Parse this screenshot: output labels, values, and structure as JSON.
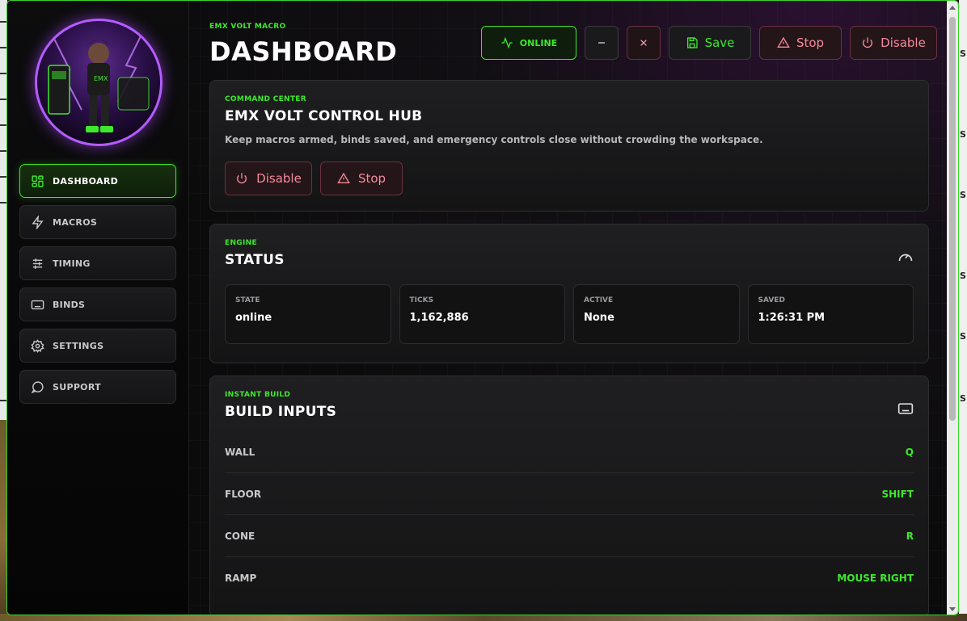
{
  "app": {
    "subtitle": "EMX VOLT MACRO",
    "title": "DASHBOARD"
  },
  "topbar": {
    "status_label": "ONLINE",
    "save_label": "Save",
    "stop_label": "Stop",
    "disable_label": "Disable"
  },
  "sidebar": {
    "items": [
      {
        "label": "DASHBOARD",
        "icon": "grid-icon",
        "active": true
      },
      {
        "label": "MACROS",
        "icon": "bolt-icon"
      },
      {
        "label": "TIMING",
        "icon": "sliders-icon"
      },
      {
        "label": "BINDS",
        "icon": "keyboard-icon"
      },
      {
        "label": "SETTINGS",
        "icon": "gear-icon"
      },
      {
        "label": "SUPPORT",
        "icon": "chat-icon"
      }
    ]
  },
  "command_center": {
    "eyebrow": "COMMAND CENTER",
    "title": "EMX VOLT CONTROL HUB",
    "description": "Keep macros armed, binds saved, and emergency controls close without crowding the workspace.",
    "disable_label": "Disable",
    "stop_label": "Stop"
  },
  "engine": {
    "eyebrow": "ENGINE",
    "title": "STATUS",
    "stats": [
      {
        "label": "STATE",
        "value": "online"
      },
      {
        "label": "TICKS",
        "value": "1,162,886"
      },
      {
        "label": "ACTIVE",
        "value": "None"
      },
      {
        "label": "SAVED",
        "value": "1:26:31 PM"
      }
    ]
  },
  "build": {
    "eyebrow": "INSTANT BUILD",
    "title": "BUILD INPUTS",
    "rows": [
      {
        "name": "WALL",
        "key": "Q"
      },
      {
        "name": "FLOOR",
        "key": "SHIFT"
      },
      {
        "name": "CONE",
        "key": "R"
      },
      {
        "name": "RAMP",
        "key": "MOUSE RIGHT"
      }
    ]
  },
  "colors": {
    "accent": "#3ee82c",
    "danger": "#f58a9a",
    "avatar_ring": "#b45cff"
  }
}
